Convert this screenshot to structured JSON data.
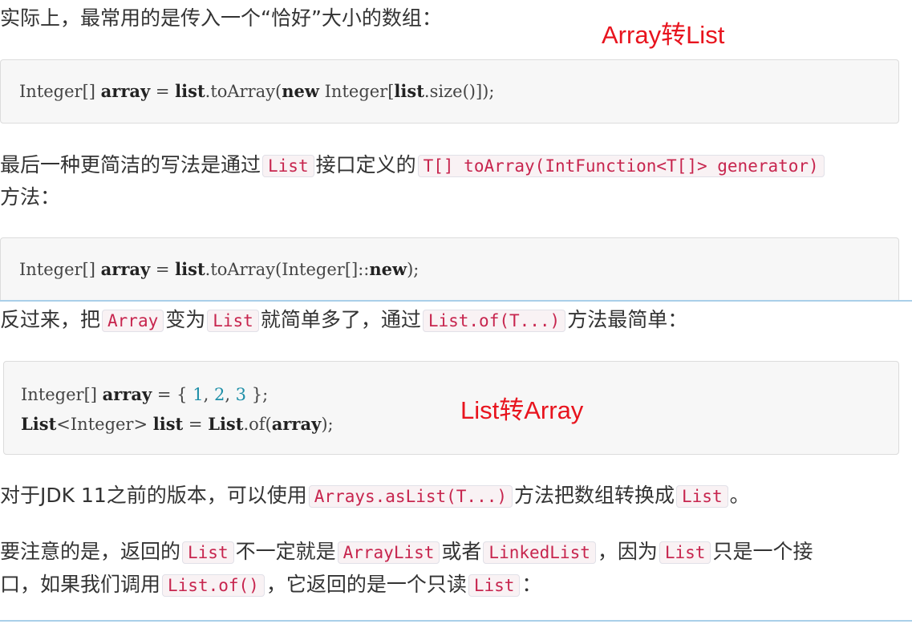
{
  "p1": {
    "text": "实际上，最常用的是传入一个“恰好”大小的数组："
  },
  "anno1": "Array转List",
  "code1": {
    "t1": "Integer[] ",
    "k1": "array",
    "t2": " = ",
    "k2": "list",
    "t3": ".toArray(",
    "k3": "new",
    "t4": " Integer[",
    "k4": "list",
    "t5": ".size()]);"
  },
  "p2": {
    "a": "最后一种更简洁的写法是通过",
    "c1": "List",
    "b": "接口定义的",
    "c2": "T[] toArray(IntFunction<T[]> generator)",
    "line2": "方法："
  },
  "code2": {
    "t1": "Integer[] ",
    "k1": "array",
    "t2": " = ",
    "k2": "list",
    "t3": ".toArray(Integer[]::",
    "k3": "new",
    "t4": ");"
  },
  "p3": {
    "a": "反过来，把",
    "c1": "Array",
    "b": "变为",
    "c2": "List",
    "c": "就简单多了，通过",
    "c3": "List.of(T...)",
    "d": "方法最简单："
  },
  "code3": {
    "l1a": "Integer[] ",
    "l1k": "array",
    "l1b": " = { ",
    "n1": "1",
    "sep1": ", ",
    "n2": "2",
    "sep2": ", ",
    "n3": "3",
    "l1c": " };",
    "l2k1": "List",
    "l2a": "<Integer> ",
    "l2k2": "list",
    "l2b": " = ",
    "l2k3": "List",
    "l2c": ".of(",
    "l2k4": "array",
    "l2d": ");"
  },
  "anno2": "List转Array",
  "p4": {
    "a": "对于JDK 11之前的版本，可以使用",
    "c1": "Arrays.asList(T...)",
    "b": "方法把数组转换成",
    "c2": "List",
    "c": "。"
  },
  "p5": {
    "a": "要注意的是，返回的",
    "c1": "List",
    "b": "不一定就是",
    "c2": "ArrayList",
    "c": "或者",
    "c3": "LinkedList",
    "d": "，因为",
    "c4": "List",
    "e": "只是一个接",
    "line2a": "口，如果我们调用",
    "c5": "List.of()",
    "line2b": "，它返回的是一个只读",
    "c6": "List",
    "line2c": "："
  }
}
